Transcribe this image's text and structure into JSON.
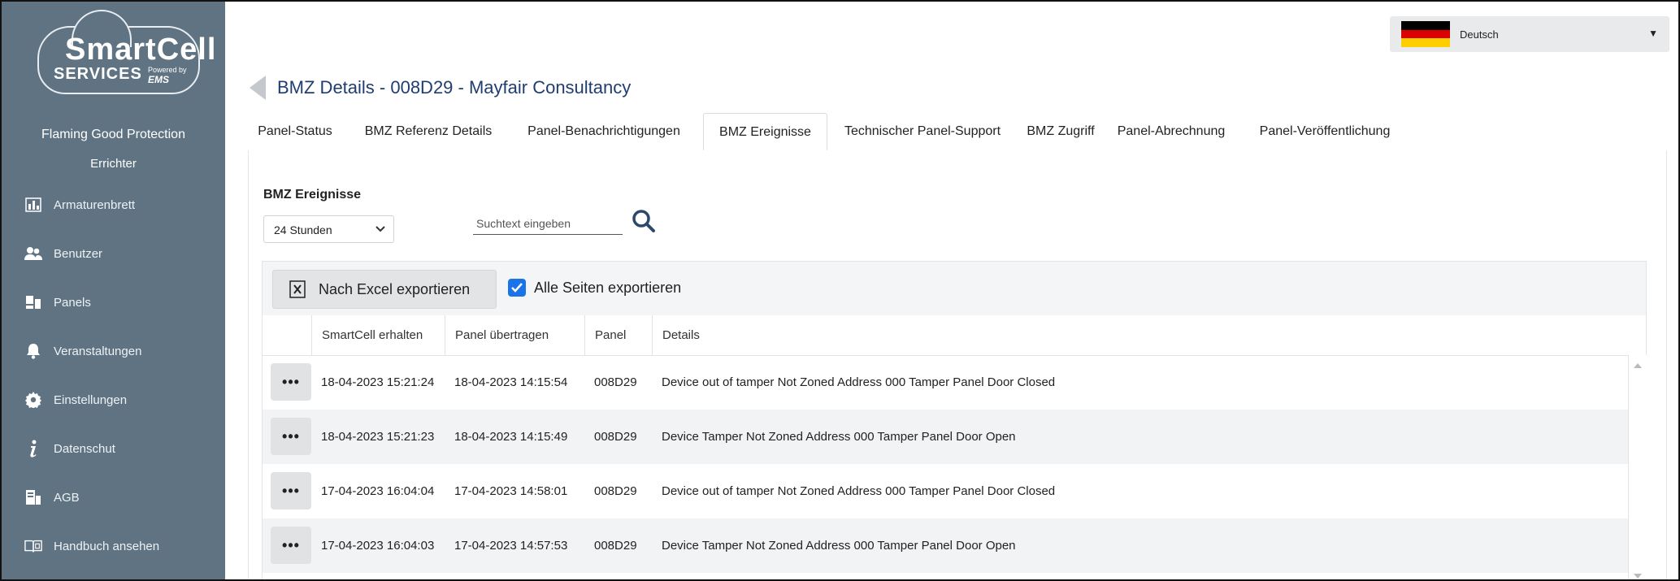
{
  "brand": {
    "name_line1": "SmartCell",
    "name_line2": "SERVICES",
    "powered_by": "Powered by",
    "powered_brand": "EMS"
  },
  "sidebar": {
    "company": "Flaming Good Protection",
    "role": "Errichter",
    "items": [
      {
        "label": "Armaturenbrett",
        "icon": "dashboard-chart-icon"
      },
      {
        "label": "Benutzer",
        "icon": "users-icon"
      },
      {
        "label": "Panels",
        "icon": "panels-icon"
      },
      {
        "label": "Veranstaltungen",
        "icon": "bell-icon"
      },
      {
        "label": "Einstellungen",
        "icon": "gear-icon"
      },
      {
        "label": "Datenschut",
        "icon": "info-icon"
      },
      {
        "label": "AGB",
        "icon": "terms-document-icon"
      },
      {
        "label": "Handbuch ansehen",
        "icon": "manual-book-icon"
      }
    ]
  },
  "header": {
    "language": "Deutsch",
    "flag_colors": [
      "#000000",
      "#dd0000",
      "#ffce00"
    ]
  },
  "page": {
    "title": "BMZ Details - 008D29 - Mayfair Consultancy"
  },
  "tabs": [
    {
      "label": "Panel-Status",
      "active": false
    },
    {
      "label": "BMZ Referenz Details",
      "active": false
    },
    {
      "label": "Panel-Benachrichtigungen",
      "active": false
    },
    {
      "label": "BMZ Ereignisse",
      "active": true
    },
    {
      "label": "Technischer Panel-Support",
      "active": false
    },
    {
      "label": "BMZ Zugriff",
      "active": false
    },
    {
      "label": "Panel-Abrechnung",
      "active": false
    },
    {
      "label": "Panel-Veröffentlichung",
      "active": false
    }
  ],
  "events": {
    "section_title": "BMZ Ereignisse",
    "period_selected": "24 Stunden",
    "search_placeholder": "Suchtext eingeben",
    "export_button": "Nach Excel exportieren",
    "export_all_pages_label": "Alle Seiten exportieren",
    "export_all_pages_checked": true,
    "columns": [
      "SmartCell erhalten",
      "Panel übertragen",
      "Panel",
      "Details"
    ],
    "rows": [
      {
        "received": "18-04-2023 15:21:24",
        "transmitted": "18-04-2023 14:15:54",
        "panel": "008D29",
        "details": "Device out of tamper Not Zoned Address 000 Tamper Panel Door Closed"
      },
      {
        "received": "18-04-2023 15:21:23",
        "transmitted": "18-04-2023 14:15:49",
        "panel": "008D29",
        "details": "Device Tamper Not Zoned Address 000 Tamper Panel Door Open"
      },
      {
        "received": "17-04-2023 16:04:04",
        "transmitted": "17-04-2023 14:58:01",
        "panel": "008D29",
        "details": "Device out of tamper Not Zoned Address 000 Tamper Panel Door Closed"
      },
      {
        "received": "17-04-2023 16:04:03",
        "transmitted": "17-04-2023 14:57:53",
        "panel": "008D29",
        "details": "Device Tamper Not Zoned Address 000 Tamper Panel Door Open"
      }
    ],
    "row_action_label": "•••"
  }
}
